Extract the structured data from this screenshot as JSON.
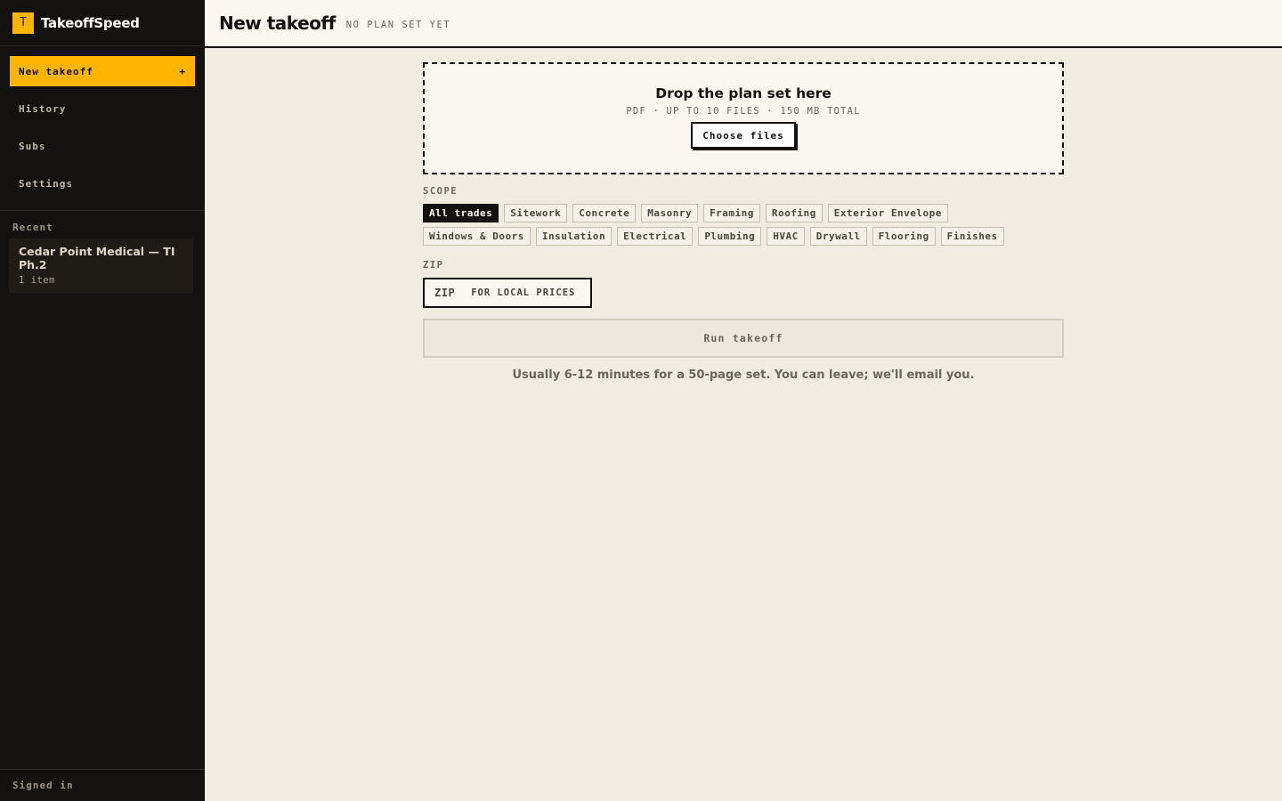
{
  "brand": {
    "logo_letter": "T",
    "name": "TakeoffSpeed"
  },
  "nav": {
    "new_takeoff": "New takeoff",
    "new_takeoff_icon": "+",
    "history": "History",
    "subs": "Subs",
    "settings": "Settings"
  },
  "recent": {
    "label": "Recent",
    "items": [
      {
        "title": "Cedar Point Medical — TI Ph.2",
        "meta": "1 item"
      }
    ]
  },
  "footer": {
    "status": "Signed in"
  },
  "header": {
    "title": "New takeoff",
    "subtitle": "NO PLAN SET YET"
  },
  "dropzone": {
    "title": "Drop the plan set here",
    "subtitle": "PDF · UP TO 10 FILES · 150 MB TOTAL",
    "button": "Choose files"
  },
  "scope": {
    "label": "SCOPE",
    "selected": "All trades",
    "chips": [
      "All trades",
      "Sitework",
      "Concrete",
      "Masonry",
      "Framing",
      "Roofing",
      "Exterior Envelope",
      "Windows & Doors",
      "Insulation",
      "Electrical",
      "Plumbing",
      "HVAC",
      "Drywall",
      "Flooring",
      "Finishes"
    ]
  },
  "zip": {
    "label": "ZIP",
    "placeholder_main": "ZIP",
    "placeholder_sub": "FOR LOCAL PRICES"
  },
  "run": {
    "label": "Run takeoff",
    "hint": "Usually 6-12 minutes for a 50-page set. You can leave; we'll email you."
  },
  "colors": {
    "accent": "#ffb400",
    "sidebar_bg": "#141210",
    "page_bg": "#f0ece2"
  }
}
